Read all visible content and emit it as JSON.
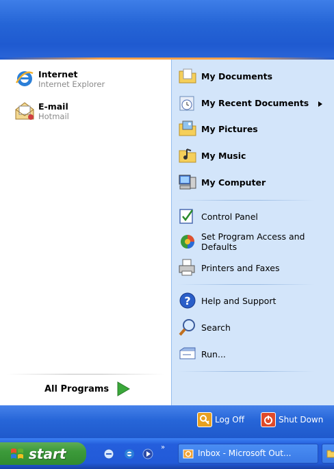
{
  "pinned": [
    {
      "title": "Internet",
      "subtitle": "Internet Explorer",
      "icon": "internet-explorer-icon"
    },
    {
      "title": "E-mail",
      "subtitle": "Hotmail",
      "icon": "email-icon"
    }
  ],
  "all_programs_label": "All Programs",
  "places": [
    {
      "label": "My Documents",
      "icon": "folder-documents-icon"
    },
    {
      "label": "My Recent Documents",
      "icon": "recent-documents-icon",
      "submenu": true
    },
    {
      "label": "My Pictures",
      "icon": "folder-pictures-icon"
    },
    {
      "label": "My Music",
      "icon": "folder-music-icon"
    },
    {
      "label": "My Computer",
      "icon": "computer-icon"
    }
  ],
  "system_items": [
    {
      "label": "Control Panel",
      "icon": "control-panel-icon"
    },
    {
      "label": "Set Program Access and Defaults",
      "icon": "program-access-icon"
    },
    {
      "label": "Printers and Faxes",
      "icon": "printer-icon"
    }
  ],
  "help_items": [
    {
      "label": "Help and Support",
      "icon": "help-icon"
    },
    {
      "label": "Search",
      "icon": "search-icon"
    },
    {
      "label": "Run...",
      "icon": "run-icon"
    }
  ],
  "footer": {
    "log_off": "Log Off",
    "shut_down": "Shut Down"
  },
  "taskbar": {
    "start_label": "start",
    "task_label": "Inbox - Microsoft Out..."
  },
  "colors": {
    "header_blue": "#2565d6",
    "right_panel": "#d3e5fa",
    "start_green": "#3c9a3a",
    "shutdown_red": "#e04a2a",
    "logoff_orange": "#e8a020"
  }
}
